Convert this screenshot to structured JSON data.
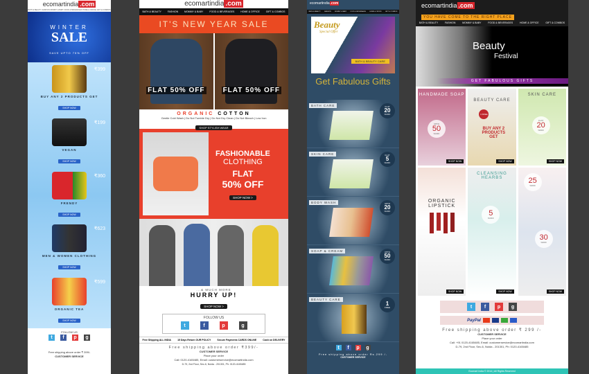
{
  "brand": {
    "name": "ecomartindia",
    ".com": ".com",
    "suffix": ".com"
  },
  "nav": [
    "BATH & BEAUTY",
    "FASHION",
    "MOMMY & BABY",
    "FOOD & BEVERAGES",
    "HOME & OFFICE",
    "GIFT & COMBOS"
  ],
  "p1": {
    "banner_top": "WINTER",
    "banner_main": "SALE",
    "banner_sub": "SAVE UPTO 75% OFF",
    "items": [
      {
        "price": "₹399",
        "caption": "BUY ANY 2 PRODUCTS GET",
        "btn": "SHOP NOW"
      },
      {
        "price": "₹199",
        "caption": "VEGAN",
        "btn": "SHOP NOW"
      },
      {
        "price": "₹360",
        "caption": "FRENDY",
        "btn": "SHOP NOW"
      },
      {
        "price": "₹623",
        "caption": "MEN & WOMEN CLOTHING",
        "btn": "SHOP NOW"
      },
      {
        "price": "₹599",
        "caption": "ORGANIC TEA",
        "btn": "SHOP NOW"
      }
    ],
    "follow": "FOLLOW US",
    "shipping": "Free shipping above order ₹ 399/-",
    "cs": "CUSTOMER SERVICE"
  },
  "p2": {
    "banner": "IT'S NEW YEAR SALE",
    "flat": "FLAT 50% OFF",
    "organic_a": "ORGANIC",
    "organic_b": "COTTON",
    "care": "Gentle Cold Wash | Do Not Tumble Dry | Do Not Dry Clean | Do Not Bleach | Low Iron",
    "shop_stylish": "SHOP STYLISH WEAR",
    "fashion1": "FASHIONABLE",
    "fashion2": "CLOTHING",
    "fashion3": "FLAT",
    "fashion4": "50% OFF",
    "shop_now": "SHOP NOW >",
    "much_more": "...& MUCH MORE",
    "hurry": "HURRY UP!",
    "hurry_btn": "SHOP NOW >",
    "follow": "FOLLOW US",
    "features": [
      "Free Shipping ALL INDIA",
      "15 Days Return OUR POLICY",
      "Secure Payments CARDS ONLINE",
      "Cash on DELIVERY"
    ],
    "shipping": "Free shipping above order ₹399/-",
    "cs": "CUSTOMER SERVICE",
    "place": "Place your order",
    "call": "Call: 0120-4165485, Email: customerservice@ecomartindia.com",
    "address": "D-79, 2nd Floor, Sec-6, Noida - 201301, Ph: 0120-4165485"
  },
  "p3": {
    "beauty": "Beauty",
    "special": "Special Offer",
    "bath_tag": "BATH & BEAUTY CARE",
    "gifts": "Get Fabulous Gifts",
    "sections": [
      {
        "label": "BATH CARE",
        "pre": "FLAT",
        "num": "20",
        "post": "%OFF"
      },
      {
        "label": "SKIN CARE",
        "pre": "FLAT",
        "num": "5",
        "post": "%OFF"
      },
      {
        "label": "BODY WASH",
        "pre": "UPTO",
        "num": "20",
        "post": "%OFF"
      },
      {
        "label": "SOAP & CREAM",
        "pre": "UPTO",
        "num": "50",
        "post": "%OFF"
      },
      {
        "label": "BEAUTY CARE",
        "pre": "",
        "num": "1",
        "post": "FREE"
      }
    ],
    "shipping": "Free shipping above order Rs.299 /-",
    "cs": "CUSTOMER SERVICE"
  },
  "p4": {
    "tagline": "YOU HAVE COME TO THE RIGHT PLACE",
    "hero1": "Beauty",
    "hero2": "Festival",
    "gifts": "GET FABULOUS GIFTS",
    "tiles": {
      "soap": "HANDMADE SOAP",
      "soap_pre": "UPTO",
      "soap_num": "50",
      "beauty": "BEAUTY CARE",
      "free": "1 FREE",
      "buy": "BUY ANY 2 PRODUCTS GET",
      "skin": "SKIN CARE",
      "skin_pre": "FLAT",
      "skin_num": "20",
      "t25": "25",
      "lip1": "ORGANIC",
      "lip2": "LIPSTICK",
      "cleansing": "CLEANSING HEARBS",
      "c5": "5",
      "t30": "30",
      "off": "%OFF",
      "shop": "SHOP NOW"
    },
    "shipping": "Free shipping above order ₹ 299 /-",
    "cs": "CUSTOMER SERVICE",
    "place": "Place your order",
    "call": "Call: +91 0120-4165485, Email: customerservice@ecomartindia.com",
    "address": "D-79, 2nd Floor, Sec-6, Noida - 201301, Ph: 0120-4165485",
    "copyright": "Ecomart India © 2014 | All Rights Reserved",
    "paypal": "PayPal"
  }
}
